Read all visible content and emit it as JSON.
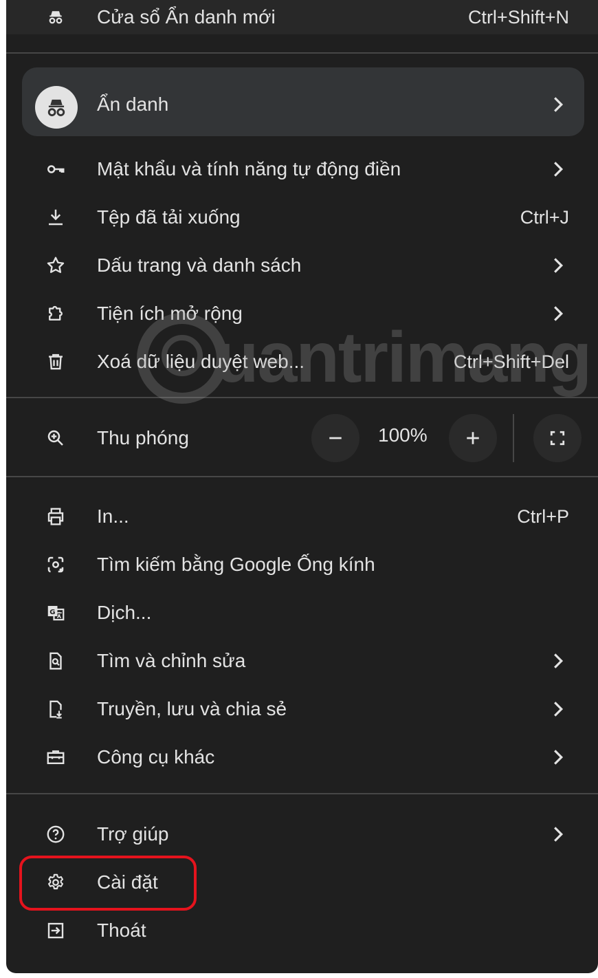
{
  "menu": {
    "new_incognito": {
      "label": "Cửa sổ Ẩn danh mới",
      "shortcut": "Ctrl+Shift+N",
      "icon": "incognito-icon"
    },
    "profile": {
      "label": "Ẩn danh",
      "icon": "incognito-avatar-icon"
    },
    "passwords": {
      "label": "Mật khẩu và tính năng tự động điền",
      "icon": "key-icon"
    },
    "downloads": {
      "label": "Tệp đã tải xuống",
      "shortcut": "Ctrl+J",
      "icon": "download-icon"
    },
    "bookmarks": {
      "label": "Dấu trang và danh sách",
      "icon": "star-icon"
    },
    "extensions": {
      "label": "Tiện ích mở rộng",
      "icon": "puzzle-icon"
    },
    "clear_data": {
      "label": "Xoá dữ liệu duyệt web...",
      "shortcut": "Ctrl+Shift+Del",
      "icon": "trash-icon"
    },
    "zoom": {
      "label": "Thu phóng",
      "value": "100%",
      "minus": "−",
      "plus": "+",
      "icon": "zoom-icon"
    },
    "print": {
      "label": "In...",
      "shortcut": "Ctrl+P",
      "icon": "print-icon"
    },
    "lens": {
      "label": "Tìm kiếm bằng Google Ống kính",
      "icon": "lens-icon"
    },
    "translate": {
      "label": "Dịch...",
      "icon": "translate-icon"
    },
    "find_edit": {
      "label": "Tìm và chỉnh sửa",
      "icon": "find-page-icon"
    },
    "cast_save_share": {
      "label": "Truyền, lưu và chia sẻ",
      "icon": "cast-save-icon"
    },
    "more_tools": {
      "label": "Công cụ khác",
      "icon": "toolbox-icon"
    },
    "help": {
      "label": "Trợ giúp",
      "icon": "help-icon"
    },
    "settings": {
      "label": "Cài đặt",
      "icon": "gear-icon"
    },
    "exit": {
      "label": "Thoát",
      "icon": "exit-icon"
    }
  },
  "watermark": {
    "text": "uantrimang"
  },
  "colors": {
    "menu_bg": "#1f1f1f",
    "text": "#e3e3e3",
    "highlight": "#e5131d",
    "separator": "#474747"
  }
}
